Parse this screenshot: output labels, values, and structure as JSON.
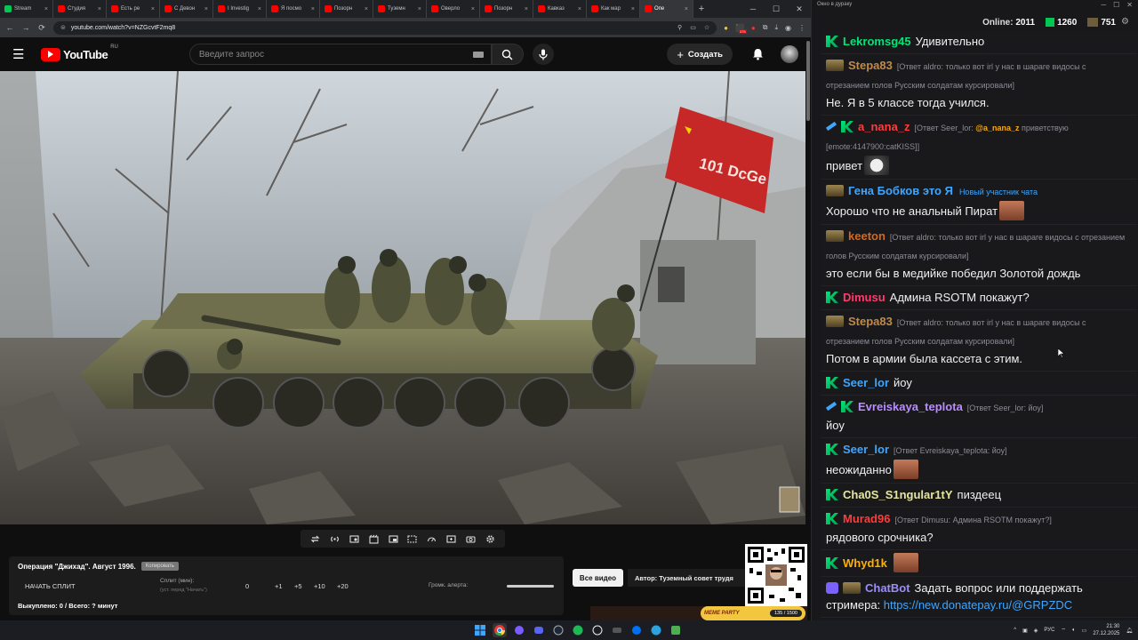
{
  "browser": {
    "tabs": [
      {
        "label": "Stream",
        "color": "#00c853"
      },
      {
        "label": "Студия",
        "color": "#ff0000"
      },
      {
        "label": "Есть ре",
        "color": "#ff0000"
      },
      {
        "label": "С Девон",
        "color": "#ff0000"
      },
      {
        "label": "I Investig",
        "color": "#ff0000"
      },
      {
        "label": "Я посмо",
        "color": "#ff0000"
      },
      {
        "label": "Позорн",
        "color": "#ff0000"
      },
      {
        "label": "Туземн",
        "color": "#ff0000"
      },
      {
        "label": "Оверло",
        "color": "#ff0000"
      },
      {
        "label": "Позорн",
        "color": "#ff0000"
      },
      {
        "label": "Кавказ",
        "color": "#ff0000"
      },
      {
        "label": "Как мар",
        "color": "#ff0000"
      },
      {
        "label": "Опе",
        "color": "#ff0000",
        "active": true
      }
    ],
    "url": "youtube.com/watch?v=NZGcvtF2mq8",
    "ext_badge": "375"
  },
  "youtube": {
    "logo_text": "YouTube",
    "region": "RU",
    "search_placeholder": "Введите запрос",
    "create_label": "Создать"
  },
  "video": {
    "flag_text": "101 DcGe"
  },
  "overlay_panel": {
    "title": "Операция \"Джихад\". Август 1996.",
    "copy_label": "Копировать",
    "start_split_label": "НАЧАТЬ СПЛИТ",
    "split_label": "Сплит (мин):",
    "split_sub": "(уст. перед \"Начать\")",
    "split_values": [
      "0",
      "+1",
      "+5",
      "+10",
      "+20"
    ],
    "alert_volume_label": "Громк. алерта:",
    "alert_volume": 1.0,
    "bought_text": "Выкуплено: 0 / Всего: ? минут"
  },
  "buttons": {
    "all_video": "Все видео",
    "author": "Автор: Туземный совет трудя"
  },
  "stream_banner": {
    "label": "MEME PARTY",
    "progress": "135 / 1500"
  },
  "chat": {
    "window_title": "Окно в дураку",
    "online_label": "Online:",
    "online_count": "2011",
    "stat_k": "1260",
    "stat_g": "751",
    "messages": [
      {
        "badges": [
          "k"
        ],
        "nick": "Lekromsg45",
        "color": "#00e676",
        "text": "Удивительно"
      },
      {
        "badges": [
          "g"
        ],
        "nick": "Stepa83",
        "color": "#c08a4a",
        "reply": "[Ответ aldro: только вот irl у нас в шараге видосы с отрезанием голов Русским солдатам курсировали]",
        "text": "Не. Я в 5 классе тогда учился."
      },
      {
        "badges": [
          "p",
          "k"
        ],
        "nick": "a_nana_z",
        "color": "#ff3b3b",
        "reply": "[Ответ Seer_lor: ",
        "reply_mention": "@a_nana_z",
        "reply_tail": " приветствую [emote:4147900:catKISS]]",
        "text": "привет",
        "emote": "cat"
      },
      {
        "badges": [
          "g"
        ],
        "nick": "Гена Бобков это Я",
        "color": "#3ea6ff",
        "newbie": "Новый участник чата",
        "text": "Хорошо что не анальный Пират",
        "emote": "face"
      },
      {
        "badges": [
          "g"
        ],
        "nick": "keeton",
        "color": "#d2691e",
        "reply": "[Ответ aldro: только вот irl у нас в шараге видосы с отрезанием голов Русским солдатам курсировали]",
        "text": "это если бы в медийке победил Золотой дождь"
      },
      {
        "badges": [
          "k"
        ],
        "nick": "Dimusu",
        "color": "#ff3b6b",
        "text": "Админа RSOTM покажут?"
      },
      {
        "badges": [
          "g"
        ],
        "nick": "Stepa83",
        "color": "#c08a4a",
        "reply": "[Ответ aldro: только вот irl у нас в шараге видосы с отрезанием голов Русским солдатам курсировали]",
        "text": "Потом в армии была кассета с этим."
      },
      {
        "badges": [
          "k"
        ],
        "nick": "Seer_lor",
        "color": "#3ea6ff",
        "text": "йоу"
      },
      {
        "badges": [
          "p",
          "k"
        ],
        "nick": "Evreiskaya_teplota",
        "color": "#b98cff",
        "reply": "[Ответ Seer_lor: йоу]",
        "text": "йоу"
      },
      {
        "badges": [
          "k"
        ],
        "nick": "Seer_lor",
        "color": "#3ea6ff",
        "reply": "[Ответ Evreiskaya_teplota: йоу]",
        "text": "неожиданно",
        "emote": "face"
      },
      {
        "badges": [
          "k"
        ],
        "nick": "Cha0S_S1ngular1tY",
        "color": "#e6e6a0",
        "text": "пиздеец"
      },
      {
        "badges": [
          "k"
        ],
        "nick": "Murad96",
        "color": "#ff3b3b",
        "reply": "[Ответ Dimusu: Админа RSOTM покажут?]",
        "text": "рядового срочника?"
      },
      {
        "badges": [
          "k"
        ],
        "nick": "Whyd1k",
        "color": "#ffb000",
        "text": "",
        "emote": "face"
      },
      {
        "badges": [
          "v",
          "g"
        ],
        "nick": "ChatBot",
        "color": "#9b8cff",
        "text": "Задать вопрос или поддержать стримера: ",
        "link": "https://new.donatepay.ru/@GRPZDC"
      }
    ]
  },
  "taskbar": {
    "lang": "РУС",
    "time": "21:30",
    "date": "27.12.2025"
  }
}
